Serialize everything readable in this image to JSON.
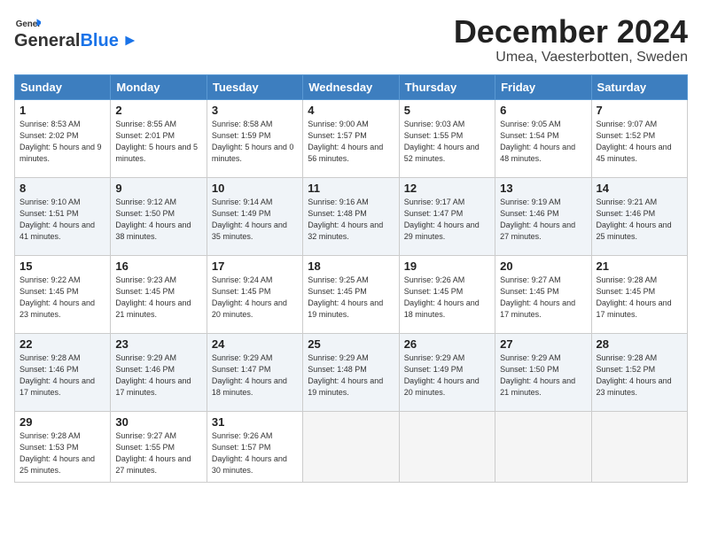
{
  "header": {
    "logo_general": "General",
    "logo_blue": "Blue",
    "title": "December 2024",
    "subtitle": "Umea, Vaesterbotten, Sweden"
  },
  "calendar": {
    "days_of_week": [
      "Sunday",
      "Monday",
      "Tuesday",
      "Wednesday",
      "Thursday",
      "Friday",
      "Saturday"
    ],
    "weeks": [
      [
        {
          "day": "1",
          "sunrise": "Sunrise: 8:53 AM",
          "sunset": "Sunset: 2:02 PM",
          "daylight": "Daylight: 5 hours and 9 minutes."
        },
        {
          "day": "2",
          "sunrise": "Sunrise: 8:55 AM",
          "sunset": "Sunset: 2:01 PM",
          "daylight": "Daylight: 5 hours and 5 minutes."
        },
        {
          "day": "3",
          "sunrise": "Sunrise: 8:58 AM",
          "sunset": "Sunset: 1:59 PM",
          "daylight": "Daylight: 5 hours and 0 minutes."
        },
        {
          "day": "4",
          "sunrise": "Sunrise: 9:00 AM",
          "sunset": "Sunset: 1:57 PM",
          "daylight": "Daylight: 4 hours and 56 minutes."
        },
        {
          "day": "5",
          "sunrise": "Sunrise: 9:03 AM",
          "sunset": "Sunset: 1:55 PM",
          "daylight": "Daylight: 4 hours and 52 minutes."
        },
        {
          "day": "6",
          "sunrise": "Sunrise: 9:05 AM",
          "sunset": "Sunset: 1:54 PM",
          "daylight": "Daylight: 4 hours and 48 minutes."
        },
        {
          "day": "7",
          "sunrise": "Sunrise: 9:07 AM",
          "sunset": "Sunset: 1:52 PM",
          "daylight": "Daylight: 4 hours and 45 minutes."
        }
      ],
      [
        {
          "day": "8",
          "sunrise": "Sunrise: 9:10 AM",
          "sunset": "Sunset: 1:51 PM",
          "daylight": "Daylight: 4 hours and 41 minutes."
        },
        {
          "day": "9",
          "sunrise": "Sunrise: 9:12 AM",
          "sunset": "Sunset: 1:50 PM",
          "daylight": "Daylight: 4 hours and 38 minutes."
        },
        {
          "day": "10",
          "sunrise": "Sunrise: 9:14 AM",
          "sunset": "Sunset: 1:49 PM",
          "daylight": "Daylight: 4 hours and 35 minutes."
        },
        {
          "day": "11",
          "sunrise": "Sunrise: 9:16 AM",
          "sunset": "Sunset: 1:48 PM",
          "daylight": "Daylight: 4 hours and 32 minutes."
        },
        {
          "day": "12",
          "sunrise": "Sunrise: 9:17 AM",
          "sunset": "Sunset: 1:47 PM",
          "daylight": "Daylight: 4 hours and 29 minutes."
        },
        {
          "day": "13",
          "sunrise": "Sunrise: 9:19 AM",
          "sunset": "Sunset: 1:46 PM",
          "daylight": "Daylight: 4 hours and 27 minutes."
        },
        {
          "day": "14",
          "sunrise": "Sunrise: 9:21 AM",
          "sunset": "Sunset: 1:46 PM",
          "daylight": "Daylight: 4 hours and 25 minutes."
        }
      ],
      [
        {
          "day": "15",
          "sunrise": "Sunrise: 9:22 AM",
          "sunset": "Sunset: 1:45 PM",
          "daylight": "Daylight: 4 hours and 23 minutes."
        },
        {
          "day": "16",
          "sunrise": "Sunrise: 9:23 AM",
          "sunset": "Sunset: 1:45 PM",
          "daylight": "Daylight: 4 hours and 21 minutes."
        },
        {
          "day": "17",
          "sunrise": "Sunrise: 9:24 AM",
          "sunset": "Sunset: 1:45 PM",
          "daylight": "Daylight: 4 hours and 20 minutes."
        },
        {
          "day": "18",
          "sunrise": "Sunrise: 9:25 AM",
          "sunset": "Sunset: 1:45 PM",
          "daylight": "Daylight: 4 hours and 19 minutes."
        },
        {
          "day": "19",
          "sunrise": "Sunrise: 9:26 AM",
          "sunset": "Sunset: 1:45 PM",
          "daylight": "Daylight: 4 hours and 18 minutes."
        },
        {
          "day": "20",
          "sunrise": "Sunrise: 9:27 AM",
          "sunset": "Sunset: 1:45 PM",
          "daylight": "Daylight: 4 hours and 17 minutes."
        },
        {
          "day": "21",
          "sunrise": "Sunrise: 9:28 AM",
          "sunset": "Sunset: 1:45 PM",
          "daylight": "Daylight: 4 hours and 17 minutes."
        }
      ],
      [
        {
          "day": "22",
          "sunrise": "Sunrise: 9:28 AM",
          "sunset": "Sunset: 1:46 PM",
          "daylight": "Daylight: 4 hours and 17 minutes."
        },
        {
          "day": "23",
          "sunrise": "Sunrise: 9:29 AM",
          "sunset": "Sunset: 1:46 PM",
          "daylight": "Daylight: 4 hours and 17 minutes."
        },
        {
          "day": "24",
          "sunrise": "Sunrise: 9:29 AM",
          "sunset": "Sunset: 1:47 PM",
          "daylight": "Daylight: 4 hours and 18 minutes."
        },
        {
          "day": "25",
          "sunrise": "Sunrise: 9:29 AM",
          "sunset": "Sunset: 1:48 PM",
          "daylight": "Daylight: 4 hours and 19 minutes."
        },
        {
          "day": "26",
          "sunrise": "Sunrise: 9:29 AM",
          "sunset": "Sunset: 1:49 PM",
          "daylight": "Daylight: 4 hours and 20 minutes."
        },
        {
          "day": "27",
          "sunrise": "Sunrise: 9:29 AM",
          "sunset": "Sunset: 1:50 PM",
          "daylight": "Daylight: 4 hours and 21 minutes."
        },
        {
          "day": "28",
          "sunrise": "Sunrise: 9:28 AM",
          "sunset": "Sunset: 1:52 PM",
          "daylight": "Daylight: 4 hours and 23 minutes."
        }
      ],
      [
        {
          "day": "29",
          "sunrise": "Sunrise: 9:28 AM",
          "sunset": "Sunset: 1:53 PM",
          "daylight": "Daylight: 4 hours and 25 minutes."
        },
        {
          "day": "30",
          "sunrise": "Sunrise: 9:27 AM",
          "sunset": "Sunset: 1:55 PM",
          "daylight": "Daylight: 4 hours and 27 minutes."
        },
        {
          "day": "31",
          "sunrise": "Sunrise: 9:26 AM",
          "sunset": "Sunset: 1:57 PM",
          "daylight": "Daylight: 4 hours and 30 minutes."
        },
        {
          "day": "",
          "sunrise": "",
          "sunset": "",
          "daylight": ""
        },
        {
          "day": "",
          "sunrise": "",
          "sunset": "",
          "daylight": ""
        },
        {
          "day": "",
          "sunrise": "",
          "sunset": "",
          "daylight": ""
        },
        {
          "day": "",
          "sunrise": "",
          "sunset": "",
          "daylight": ""
        }
      ]
    ]
  }
}
